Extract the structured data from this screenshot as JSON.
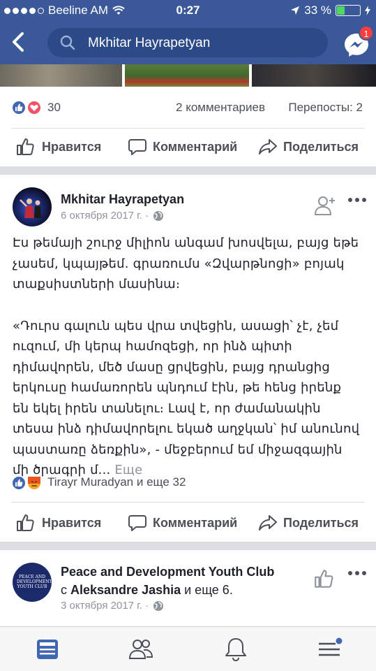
{
  "status_bar": {
    "carrier": "Beeline AM",
    "time": "0:27",
    "battery_percent": "33 %",
    "battery_level": 0.33
  },
  "header": {
    "search_text": "Mkhitar Hayrapetyan",
    "messenger_badge": "1"
  },
  "post1": {
    "reactions_count": "30",
    "comments": "2 комментариев",
    "shares": "Перепосты: 2"
  },
  "actions": {
    "like": "Нравится",
    "comment": "Комментарий",
    "share": "Поделиться"
  },
  "post2": {
    "author": "Mkhitar Hayrapetyan",
    "date": "6 октября 2017 г. ·",
    "paragraph1": "Էս թեմայի շուրջ միլիոն անգամ խոսվելա, բայց եթե չասեմ, կպայթեմ. գրառումս «Զվարթնոցի» բոյակ տաքսիստների մասինա։",
    "paragraph2": "«Դուրս գալուն պես վրա տվեցին, ասացի՝ չէ, չեմ ուզում, մի կերպ համոզեցի, որ ինձ պիտի դիմավորեն, մեծ մասը ցրվեցին, բայց դրանցից երկուսը համառորեն պնդում էին, թե հենց իրենք են եկել իրեն տանելու։ Լավ է, որ ժամանակին տեսա ինձ դիմավորելու եկած աղջկան՝ իմ անունով պաստառը ձեռքին», - մեջբերում եմ միջազգային մի ծրագրի մ...",
    "see_more": "Еще",
    "likers": "Tirayr Muradyan и еще 32"
  },
  "post3": {
    "author": "Peace and Development Youth Club",
    "with_prefix": "с",
    "with_name": "Aleksandre Jashia",
    "with_suffix": "и еще 6.",
    "date": "3 октября 2017 г. ·",
    "logo_text": "PEACE AND DEVELOPMENT YOUTH CLUB"
  },
  "colors": {
    "brand_blue": "#3b5998",
    "like_blue": "#4267b2",
    "love_red": "#f25268",
    "angry_orange": "#f5a623",
    "badge_red": "#fa3e3e"
  },
  "icons": {
    "back": "chevron-left-icon",
    "search": "search-icon",
    "messenger": "messenger-icon",
    "like": "thumbs-up-icon",
    "comment": "comment-bubble-icon",
    "share": "share-arrow-icon",
    "add_friend": "add-friend-icon",
    "globe": "globe-icon",
    "feed": "news-feed-icon",
    "friends": "friends-icon",
    "notifications": "bell-icon",
    "menu": "menu-icon"
  }
}
